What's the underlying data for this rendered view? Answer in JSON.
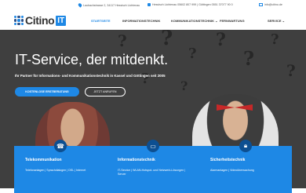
{
  "topbar": {
    "address": "Laubachstrasse 2, 34117 Hessisch Lichtenau",
    "phones": "Hessisch Lichtenau 05602 807 999 | Göttingen 0551 37077 90 0",
    "email": "info@citino.de"
  },
  "logo": {
    "text": "Citino",
    "badge": "IT"
  },
  "nav": {
    "items": [
      "STARTSEITE",
      "INFORMATIONSTECHNIK",
      "KOMMUNIKATIONSTECHNIK ⌄",
      "FERNWARTUNG",
      "SERVICE ⌄"
    ],
    "active_index": 0
  },
  "hero": {
    "headline": "IT-Service, der mitdenkt.",
    "subline": "Ihr Partner für Informations- und Kommunikationstechnik in Kassel und Göttingen seit 2005",
    "cta_primary": "KOSTENLOSE ERSTBERATUNG",
    "cta_secondary": "JETZT ANRUFEN"
  },
  "cards": [
    {
      "title": "Telekommunikation",
      "text": "Telefonanlagen | Sprachdialogen | DSL | Internet"
    },
    {
      "title": "Informationstechnik",
      "text": "IT-Service | WLAN-Hotspot- und Netzwerk-Lösungen | Server"
    },
    {
      "title": "Sicherheitstechnik",
      "text": "Alarmanlagen | Videoüberwachung"
    }
  ],
  "colors": {
    "accent": "#1e88e5",
    "dark": "#3f3f3f"
  },
  "icons": [
    "map-pin-icon",
    "phone-icon",
    "mail-icon",
    "phone-handset-icon",
    "monitor-icon",
    "lock-icon"
  ]
}
